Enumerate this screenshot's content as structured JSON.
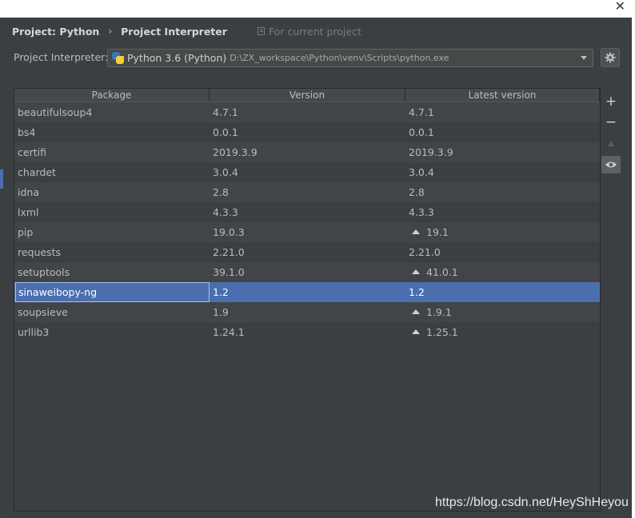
{
  "breadcrumb": {
    "root": "Project: Python",
    "separator": "›",
    "current": "Project Interpreter",
    "scope": "For current project"
  },
  "interpreter": {
    "label": "Project Interpreter:",
    "name": "Python 3.6 (Python)",
    "path": "D:\\ZX_workspace\\Python\\venv\\Scripts\\python.exe",
    "icon": "python-icon"
  },
  "table": {
    "headers": [
      "Package",
      "Version",
      "Latest version"
    ],
    "rows": [
      {
        "package": "beautifulsoup4",
        "version": "4.7.1",
        "latest": "4.7.1",
        "upgrade": false
      },
      {
        "package": "bs4",
        "version": "0.0.1",
        "latest": "0.0.1",
        "upgrade": false
      },
      {
        "package": "certifi",
        "version": "2019.3.9",
        "latest": "2019.3.9",
        "upgrade": false
      },
      {
        "package": "chardet",
        "version": "3.0.4",
        "latest": "3.0.4",
        "upgrade": false
      },
      {
        "package": "idna",
        "version": "2.8",
        "latest": "2.8",
        "upgrade": false
      },
      {
        "package": "lxml",
        "version": "4.3.3",
        "latest": "4.3.3",
        "upgrade": false
      },
      {
        "package": "pip",
        "version": "19.0.3",
        "latest": "19.1",
        "upgrade": true
      },
      {
        "package": "requests",
        "version": "2.21.0",
        "latest": "2.21.0",
        "upgrade": false
      },
      {
        "package": "setuptools",
        "version": "39.1.0",
        "latest": "41.0.1",
        "upgrade": true
      },
      {
        "package": "sinaweibopy-ng",
        "version": "1.2",
        "latest": "1.2",
        "upgrade": false,
        "selected": true
      },
      {
        "package": "soupsieve",
        "version": "1.9",
        "latest": "1.9.1",
        "upgrade": true
      },
      {
        "package": "urllib3",
        "version": "1.24.1",
        "latest": "1.25.1",
        "upgrade": true
      }
    ]
  },
  "tools": {
    "add": "+",
    "remove": "−",
    "upgrade": "▲",
    "show_early_releases": "eye-icon"
  },
  "window": {
    "close": "✕"
  },
  "watermark": "https://blog.csdn.net/HeyShHeyou",
  "colors": {
    "panel": "#3c3f41",
    "selection": "#4b6eaf",
    "text": "#bbbbbb"
  }
}
